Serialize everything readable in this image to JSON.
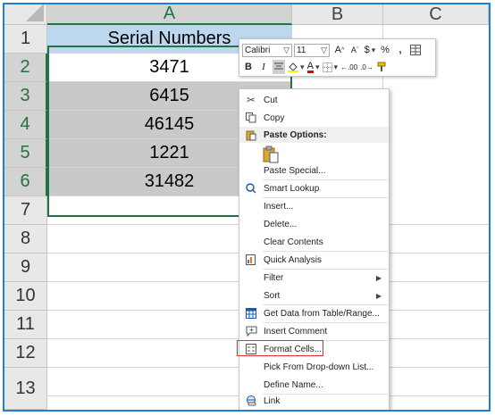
{
  "sheet": {
    "columns": [
      "A",
      "B",
      "C"
    ],
    "rows": [
      "1",
      "2",
      "3",
      "4",
      "5",
      "6",
      "7",
      "8",
      "9",
      "10",
      "11",
      "12",
      "13"
    ],
    "header_cell": "Serial Numbers",
    "values": [
      "3471",
      "6415",
      "46145",
      "1221",
      "31482"
    ]
  },
  "mini_toolbar": {
    "font_name": "Calibri",
    "font_size": "11",
    "bold": "B",
    "italic": "I",
    "font_color_letter": "A",
    "grow_font": "A",
    "shrink_font": "A",
    "currency": "$",
    "percent": "%",
    "comma": ",",
    "inc_decimal": ".00",
    "dec_decimal": ".0"
  },
  "context_menu": {
    "items": [
      {
        "label": "Cut",
        "icon": "scissors-icon"
      },
      {
        "label": "Copy",
        "icon": "copy-icon"
      },
      {
        "label": "Paste Options:",
        "icon": "paste-icon"
      },
      {
        "label": "Paste Special...",
        "icon": ""
      },
      {
        "label": "Smart Lookup",
        "icon": "smart-lookup-icon"
      },
      {
        "label": "Insert...",
        "icon": ""
      },
      {
        "label": "Delete...",
        "icon": ""
      },
      {
        "label": "Clear Contents",
        "icon": ""
      },
      {
        "label": "Quick Analysis",
        "icon": "quick-analysis-icon"
      },
      {
        "label": "Filter",
        "icon": ""
      },
      {
        "label": "Sort",
        "icon": ""
      },
      {
        "label": "Get Data from Table/Range...",
        "icon": "table-icon"
      },
      {
        "label": "Insert Comment",
        "icon": "comment-icon"
      },
      {
        "label": "Format Cells...",
        "icon": "format-cells-icon"
      },
      {
        "label": "Pick From Drop-down List...",
        "icon": ""
      },
      {
        "label": "Define Name...",
        "icon": ""
      },
      {
        "label": "Link",
        "icon": "link-icon"
      }
    ]
  },
  "colors": {
    "excel_green": "#217346",
    "header_fill": "#bdd7ee",
    "selection_fill": "#c9c9c9",
    "highlight_border": "#e03030",
    "frame_border": "#1f7fd8"
  }
}
